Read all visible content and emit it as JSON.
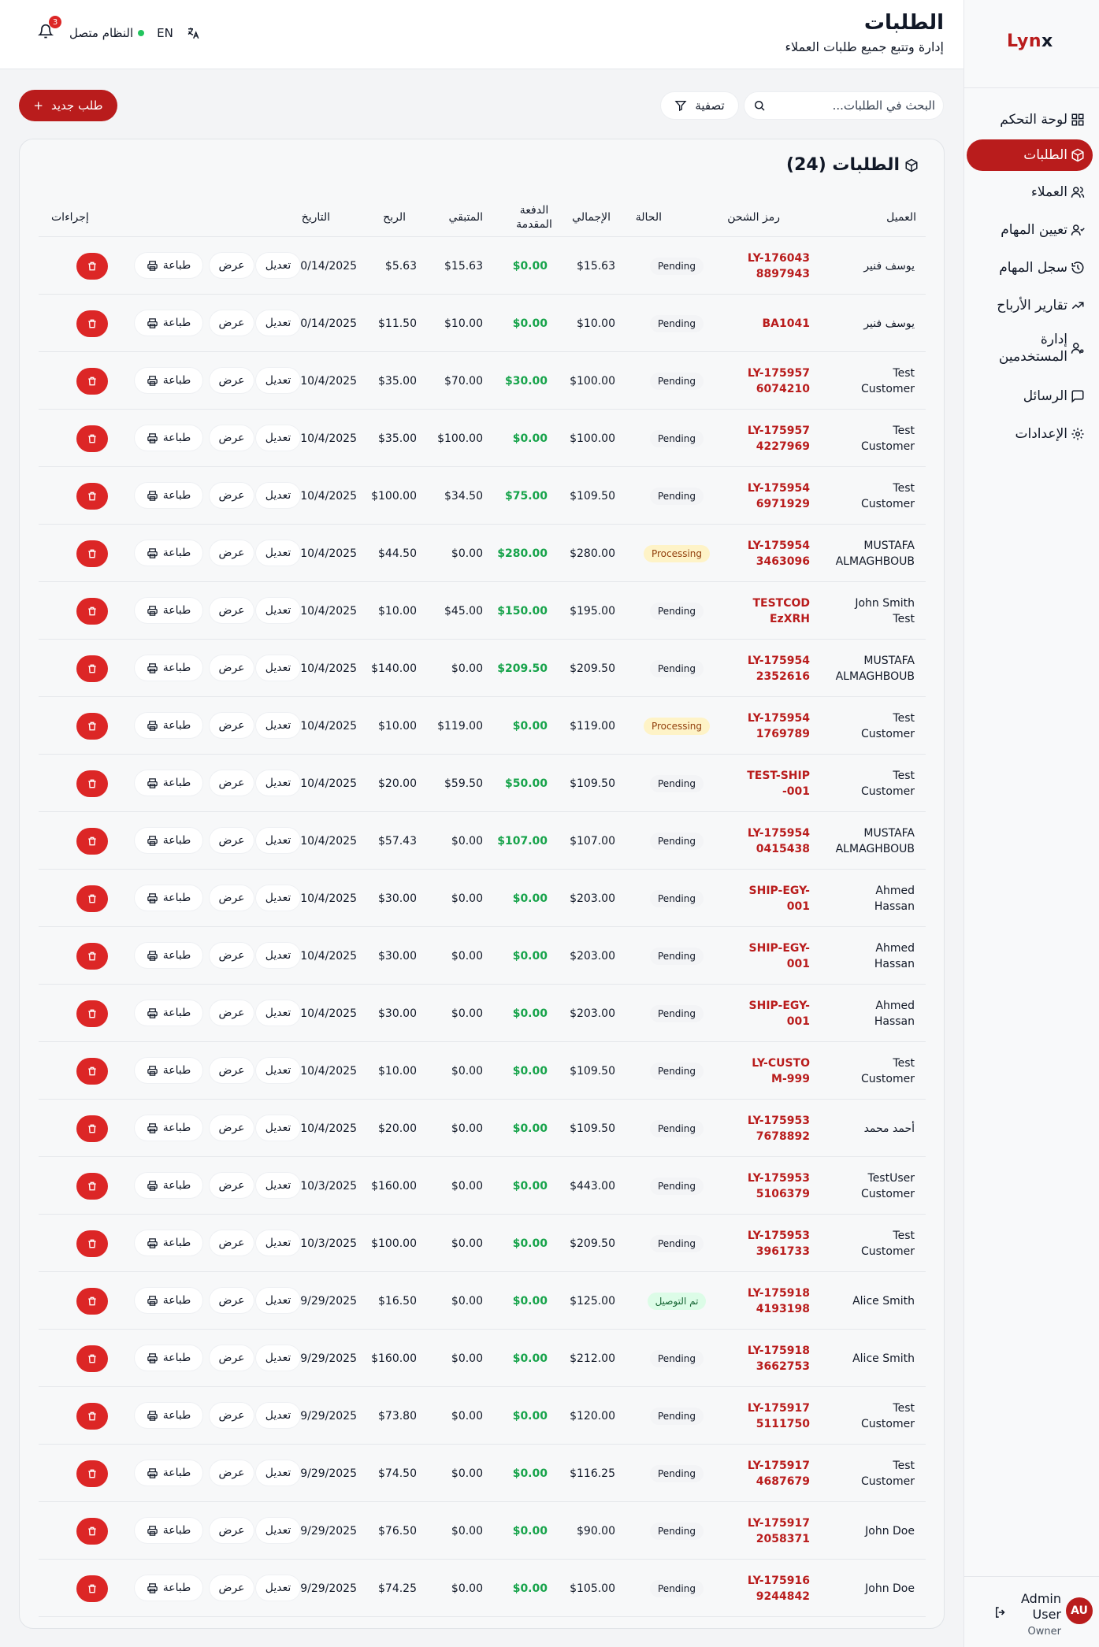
{
  "brand": {
    "logo_main": "Lyn",
    "logo_x": "x"
  },
  "header": {
    "title": "الطلبات",
    "subtitle": "إدارة وتتبع جميع طلبات العملاء",
    "notification_count": "3",
    "system_status": "النظام متصل",
    "language": "EN"
  },
  "sidebar": {
    "items": [
      {
        "label": "لوحة التحكم",
        "icon": "dashboard-icon"
      },
      {
        "label": "الطلبات",
        "icon": "box-icon"
      },
      {
        "label": "العملاء",
        "icon": "users-icon"
      },
      {
        "label": "تعيين المهام",
        "icon": "user-task-icon"
      },
      {
        "label": "سجل المهام",
        "icon": "history-icon"
      },
      {
        "label": "تقارير الأرباح",
        "icon": "trend-icon"
      },
      {
        "label": "إدارة المستخدمين",
        "icon": "user-manage-icon"
      },
      {
        "label": "الرسائل",
        "icon": "message-icon"
      },
      {
        "label": "الإعدادات",
        "icon": "settings-icon"
      }
    ],
    "user": {
      "initials": "AU",
      "name": "Admin User",
      "role": "Owner"
    }
  },
  "toolbar": {
    "new_order_label": "طلب جديد",
    "filter_label": "تصفية",
    "search_placeholder": "البحث في الطلبات..."
  },
  "table": {
    "title": "الطلبات (24)",
    "columns": {
      "customer": "العميل",
      "shipping_code": "رمز الشحن",
      "status": "الحالة",
      "total": "الإجمالي",
      "deposit": "الدفعة المقدمة",
      "remaining": "المتبقي",
      "profit": "الربح",
      "date": "التاريخ",
      "actions": "إجراءات"
    },
    "action_labels": {
      "edit": "تعديل",
      "view": "عرض",
      "print": "طباعة"
    },
    "rows": [
      {
        "customer": "يوسف فنير",
        "code": "LY-1760438897943",
        "status": "Pending",
        "total": "$15.63",
        "deposit": "$0.00",
        "remaining": "$15.63",
        "profit": "$5.63",
        "date": "10/14/2025"
      },
      {
        "customer": "يوسف فنير",
        "code": "BA1041",
        "status": "Pending",
        "total": "$10.00",
        "deposit": "$0.00",
        "remaining": "$10.00",
        "profit": "$11.50",
        "date": "10/14/2025"
      },
      {
        "customer": "Test Customer",
        "code": "LY-1759576074210",
        "status": "Pending",
        "total": "$100.00",
        "deposit": "$30.00",
        "remaining": "$70.00",
        "profit": "$35.00",
        "date": "10/4/2025"
      },
      {
        "customer": "Test Customer",
        "code": "LY-1759574227969",
        "status": "Pending",
        "total": "$100.00",
        "deposit": "$0.00",
        "remaining": "$100.00",
        "profit": "$35.00",
        "date": "10/4/2025"
      },
      {
        "customer": "Test Customer",
        "code": "LY-1759546971929",
        "status": "Pending",
        "total": "$109.50",
        "deposit": "$75.00",
        "remaining": "$34.50",
        "profit": "$100.00",
        "date": "10/4/2025"
      },
      {
        "customer": "MUSTAFA ALMAGHBOUB",
        "code": "LY-1759543463096",
        "status": "Processing",
        "total": "$280.00",
        "deposit": "$280.00",
        "remaining": "$0.00",
        "profit": "$44.50",
        "date": "10/4/2025"
      },
      {
        "customer": "John Smith Test",
        "code": "TESTCODEzXRH",
        "status": "Pending",
        "total": "$195.00",
        "deposit": "$150.00",
        "remaining": "$45.00",
        "profit": "$10.00",
        "date": "10/4/2025"
      },
      {
        "customer": "MUSTAFA ALMAGHBOUB",
        "code": "LY-1759542352616",
        "status": "Pending",
        "total": "$209.50",
        "deposit": "$209.50",
        "remaining": "$0.00",
        "profit": "$140.00",
        "date": "10/4/2025"
      },
      {
        "customer": "Test Customer",
        "code": "LY-1759541769789",
        "status": "Processing",
        "total": "$119.00",
        "deposit": "$0.00",
        "remaining": "$119.00",
        "profit": "$10.00",
        "date": "10/4/2025"
      },
      {
        "customer": "Test Customer",
        "code": "TEST-SHIP-001",
        "status": "Pending",
        "total": "$109.50",
        "deposit": "$50.00",
        "remaining": "$59.50",
        "profit": "$20.00",
        "date": "10/4/2025"
      },
      {
        "customer": "MUSTAFA ALMAGHBOUB",
        "code": "LY-1759540415438",
        "status": "Pending",
        "total": "$107.00",
        "deposit": "$107.00",
        "remaining": "$0.00",
        "profit": "$57.43",
        "date": "10/4/2025"
      },
      {
        "customer": "Ahmed Hassan",
        "code": "SHIP-EGY-001",
        "status": "Pending",
        "total": "$203.00",
        "deposit": "$0.00",
        "remaining": "$0.00",
        "profit": "$30.00",
        "date": "10/4/2025"
      },
      {
        "customer": "Ahmed Hassan",
        "code": "SHIP-EGY-001",
        "status": "Pending",
        "total": "$203.00",
        "deposit": "$0.00",
        "remaining": "$0.00",
        "profit": "$30.00",
        "date": "10/4/2025"
      },
      {
        "customer": "Ahmed Hassan",
        "code": "SHIP-EGY-001",
        "status": "Pending",
        "total": "$203.00",
        "deposit": "$0.00",
        "remaining": "$0.00",
        "profit": "$30.00",
        "date": "10/4/2025"
      },
      {
        "customer": "Test Customer",
        "code": "LY-CUSTOM-999",
        "status": "Pending",
        "total": "$109.50",
        "deposit": "$0.00",
        "remaining": "$0.00",
        "profit": "$10.00",
        "date": "10/4/2025"
      },
      {
        "customer": "أحمد محمد",
        "code": "LY-1759537678892",
        "status": "Pending",
        "total": "$109.50",
        "deposit": "$0.00",
        "remaining": "$0.00",
        "profit": "$20.00",
        "date": "10/4/2025"
      },
      {
        "customer": "TestUser Customer",
        "code": "LY-1759535106379",
        "status": "Pending",
        "total": "$443.00",
        "deposit": "$0.00",
        "remaining": "$0.00",
        "profit": "$160.00",
        "date": "10/3/2025"
      },
      {
        "customer": "Test Customer",
        "code": "LY-1759533961733",
        "status": "Pending",
        "total": "$209.50",
        "deposit": "$0.00",
        "remaining": "$0.00",
        "profit": "$100.00",
        "date": "10/3/2025"
      },
      {
        "customer": "Alice Smith",
        "code": "LY-1759184193198",
        "status": "تم التوصيل",
        "total": "$125.00",
        "deposit": "$0.00",
        "remaining": "$0.00",
        "profit": "$16.50",
        "date": "9/29/2025"
      },
      {
        "customer": "Alice Smith",
        "code": "LY-1759183662753",
        "status": "Pending",
        "total": "$212.00",
        "deposit": "$0.00",
        "remaining": "$0.00",
        "profit": "$160.00",
        "date": "9/29/2025"
      },
      {
        "customer": "Test Customer",
        "code": "LY-1759175111750",
        "status": "Pending",
        "total": "$120.00",
        "deposit": "$0.00",
        "remaining": "$0.00",
        "profit": "$73.80",
        "date": "9/29/2025"
      },
      {
        "customer": "Test Customer",
        "code": "LY-1759174687679",
        "status": "Pending",
        "total": "$116.25",
        "deposit": "$0.00",
        "remaining": "$0.00",
        "profit": "$74.50",
        "date": "9/29/2025"
      },
      {
        "customer": "John Doe",
        "code": "LY-1759172058371",
        "status": "Pending",
        "total": "$90.00",
        "deposit": "$0.00",
        "remaining": "$0.00",
        "profit": "$76.50",
        "date": "9/29/2025"
      },
      {
        "customer": "John Doe",
        "code": "LY-1759169244842",
        "status": "Pending",
        "total": "$105.00",
        "deposit": "$0.00",
        "remaining": "$0.00",
        "profit": "$74.25",
        "date": "9/29/2025"
      }
    ]
  }
}
